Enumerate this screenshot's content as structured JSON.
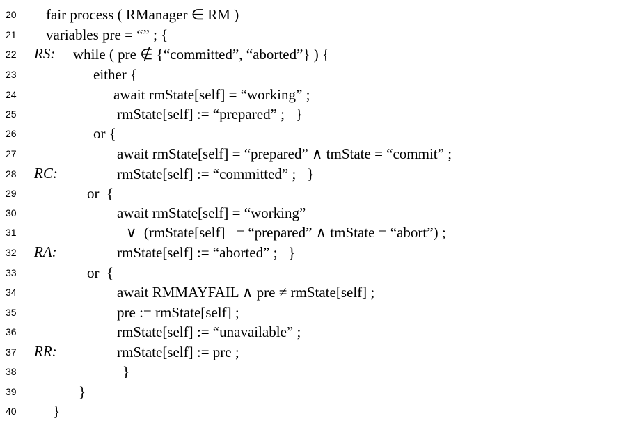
{
  "listing": {
    "lines": [
      {
        "num": "20",
        "label": "",
        "code": "fair process ( RManager ∈ RM )"
      },
      {
        "num": "21",
        "label": "",
        "code": "variables pre = “” ; {"
      },
      {
        "num": "22",
        "label": "RS:",
        "code": "while ( pre ∉ {“committed”, “aborted”} ) {"
      },
      {
        "num": "23",
        "label": "",
        "code": "either {"
      },
      {
        "num": "24",
        "label": "",
        "code": "await rmState[self] = “working” ;"
      },
      {
        "num": "25",
        "label": "",
        "code": "rmState[self] := “prepared” ;   }"
      },
      {
        "num": "26",
        "label": "",
        "code": "or {"
      },
      {
        "num": "27",
        "label": "",
        "code": "await rmState[self] = “prepared” ∧ tmState = “commit” ;"
      },
      {
        "num": "28",
        "label": "RC:",
        "code": "rmState[self] := “committed” ;   }"
      },
      {
        "num": "29",
        "label": "",
        "code": "or  {"
      },
      {
        "num": "30",
        "label": "",
        "code": "await rmState[self] = “working”"
      },
      {
        "num": "31",
        "label": "",
        "code": "∨  (rmState[self]   = “prepared” ∧ tmState = “abort”) ;"
      },
      {
        "num": "32",
        "label": "RA:",
        "code": "rmState[self] := “aborted” ;   }"
      },
      {
        "num": "33",
        "label": "",
        "code": "or  {"
      },
      {
        "num": "34",
        "label": "",
        "code": "await RMMAYFAIL ∧ pre ≠ rmState[self] ;"
      },
      {
        "num": "35",
        "label": "",
        "code": "pre := rmState[self] ;"
      },
      {
        "num": "36",
        "label": "",
        "code": "rmState[self] := “unavailable” ;"
      },
      {
        "num": "37",
        "label": "RR:",
        "code": "rmState[self] := pre ;"
      },
      {
        "num": "38",
        "label": "",
        "code": "}"
      },
      {
        "num": "39",
        "label": "",
        "code": "}"
      },
      {
        "num": "40",
        "label": "",
        "code": "}"
      }
    ]
  }
}
